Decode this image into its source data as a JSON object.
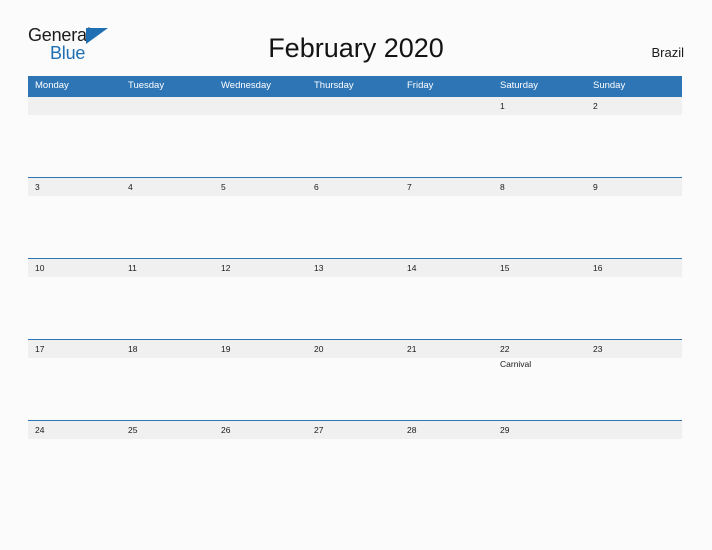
{
  "brand": {
    "name_line1": "General",
    "name_line2": "Blue",
    "triangle_color": "#1f6fb2",
    "text_color": "#1b1b1b"
  },
  "header": {
    "title": "February 2020",
    "country": "Brazil"
  },
  "theme": {
    "header_blue": "#2e75b6",
    "band_gray": "#f0f0f0",
    "page_background": "#fbfbfc",
    "text": "#1a1a1a"
  },
  "calendar": {
    "month": "February",
    "year": "2020",
    "week_start": "Monday",
    "weekdays": [
      "Monday",
      "Tuesday",
      "Wednesday",
      "Thursday",
      "Friday",
      "Saturday",
      "Sunday"
    ],
    "weeks": [
      {
        "days": [
          {
            "num": "",
            "events": []
          },
          {
            "num": "",
            "events": []
          },
          {
            "num": "",
            "events": []
          },
          {
            "num": "",
            "events": []
          },
          {
            "num": "",
            "events": []
          },
          {
            "num": "1",
            "events": []
          },
          {
            "num": "2",
            "events": []
          }
        ]
      },
      {
        "days": [
          {
            "num": "3",
            "events": []
          },
          {
            "num": "4",
            "events": []
          },
          {
            "num": "5",
            "events": []
          },
          {
            "num": "6",
            "events": []
          },
          {
            "num": "7",
            "events": []
          },
          {
            "num": "8",
            "events": []
          },
          {
            "num": "9",
            "events": []
          }
        ]
      },
      {
        "days": [
          {
            "num": "10",
            "events": []
          },
          {
            "num": "11",
            "events": []
          },
          {
            "num": "12",
            "events": []
          },
          {
            "num": "13",
            "events": []
          },
          {
            "num": "14",
            "events": []
          },
          {
            "num": "15",
            "events": []
          },
          {
            "num": "16",
            "events": []
          }
        ]
      },
      {
        "days": [
          {
            "num": "17",
            "events": []
          },
          {
            "num": "18",
            "events": []
          },
          {
            "num": "19",
            "events": []
          },
          {
            "num": "20",
            "events": []
          },
          {
            "num": "21",
            "events": []
          },
          {
            "num": "22",
            "events": [
              "Carnival"
            ]
          },
          {
            "num": "23",
            "events": []
          }
        ]
      },
      {
        "days": [
          {
            "num": "24",
            "events": []
          },
          {
            "num": "25",
            "events": []
          },
          {
            "num": "26",
            "events": []
          },
          {
            "num": "27",
            "events": []
          },
          {
            "num": "28",
            "events": []
          },
          {
            "num": "29",
            "events": []
          },
          {
            "num": "",
            "events": []
          }
        ]
      }
    ]
  }
}
